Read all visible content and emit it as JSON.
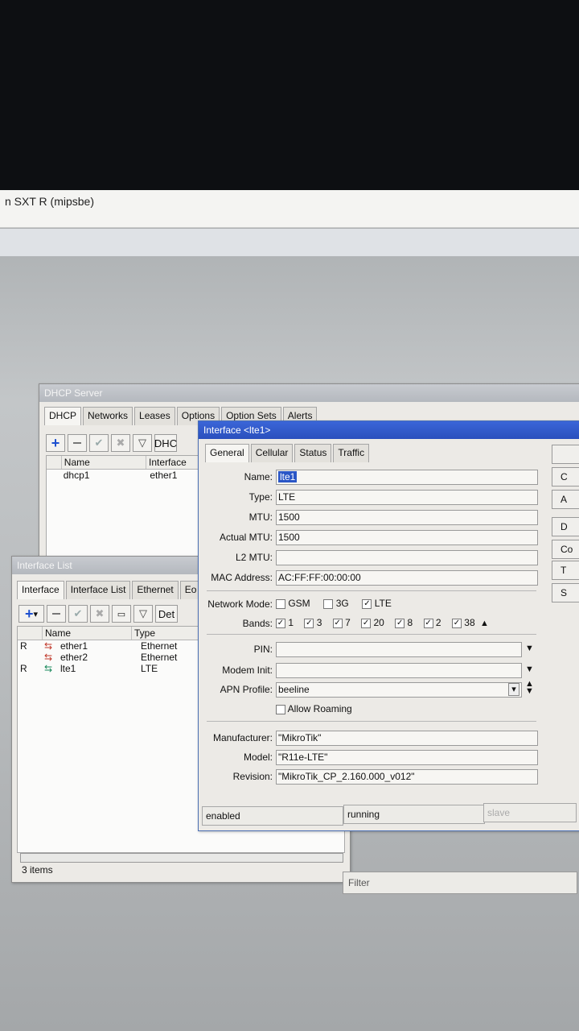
{
  "app_title": "n SXT R (mipsbe)",
  "dhcp": {
    "title": "DHCP Server",
    "tabs": [
      "DHCP",
      "Networks",
      "Leases",
      "Options",
      "Option Sets",
      "Alerts"
    ],
    "filter_label": "DHC",
    "columns": [
      "Name",
      "Interface"
    ],
    "rows": [
      {
        "name": "dhcp1",
        "interface": "ether1"
      }
    ]
  },
  "iflist": {
    "title": "Interface List",
    "tabs": [
      "Interface",
      "Interface List",
      "Ethernet",
      "Eo"
    ],
    "detail_label": "Det",
    "columns": [
      "Name",
      "Type"
    ],
    "rows": [
      {
        "flag": "R",
        "name": "ether1",
        "type": "Ethernet"
      },
      {
        "flag": "",
        "name": "ether2",
        "type": "Ethernet"
      },
      {
        "flag": "R",
        "name": "lte1",
        "type": "LTE"
      }
    ],
    "status": "3 items"
  },
  "lte": {
    "title": "Interface <lte1>",
    "tabs": [
      "General",
      "Cellular",
      "Status",
      "Traffic"
    ],
    "labels": {
      "name": "Name:",
      "type": "Type:",
      "mtu": "MTU:",
      "actual_mtu": "Actual MTU:",
      "l2mtu": "L2 MTU:",
      "mac": "MAC Address:",
      "network_mode": "Network Mode:",
      "bands": "Bands:",
      "pin": "PIN:",
      "modem_init": "Modem Init:",
      "apn_profile": "APN Profile:",
      "allow_roaming": "Allow Roaming",
      "manufacturer": "Manufacturer:",
      "model": "Model:",
      "revision": "Revision:"
    },
    "values": {
      "name": "lte1",
      "type": "LTE",
      "mtu": "1500",
      "actual_mtu": "1500",
      "l2mtu": "",
      "mac": "AC:FF:FF:00:00:00",
      "pin": "",
      "modem_init": "",
      "apn_profile": "beeline",
      "manufacturer": "\"MikroTik\"",
      "model": "\"R11e-LTE\"",
      "revision": "\"MikroTik_CP_2.160.000_v012\""
    },
    "network_modes": [
      {
        "label": "GSM",
        "checked": false
      },
      {
        "label": "3G",
        "checked": false
      },
      {
        "label": "LTE",
        "checked": true
      }
    ],
    "bands": [
      "1",
      "3",
      "7",
      "20",
      "8",
      "2",
      "38"
    ],
    "status": {
      "left": "enabled",
      "mid": "running",
      "right": "slave"
    },
    "side_buttons": [
      "C",
      "A",
      "D",
      "Co",
      "T",
      "S"
    ]
  },
  "footer_label": "Filter"
}
